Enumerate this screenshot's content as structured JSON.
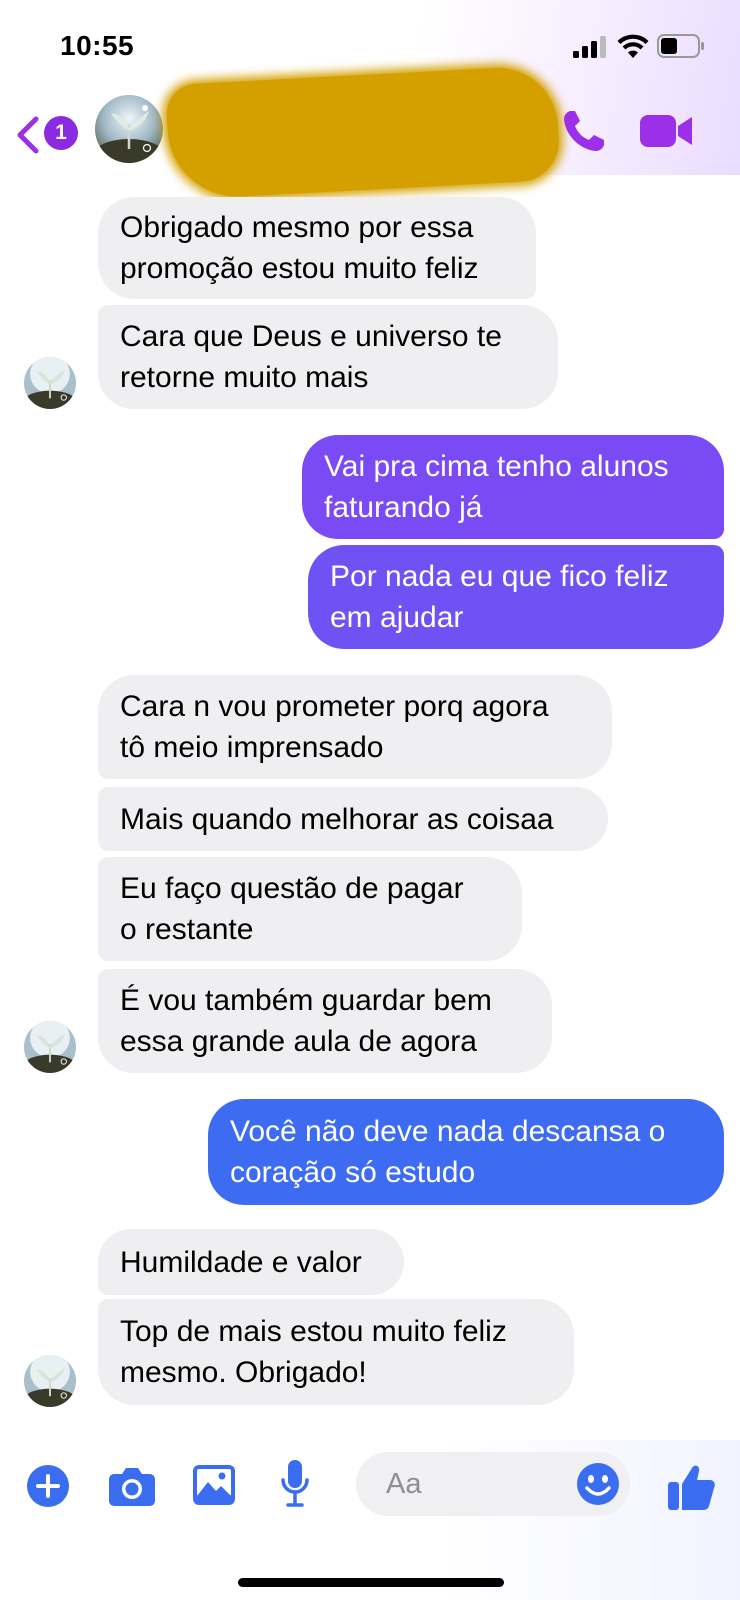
{
  "status_bar": {
    "time": "10:55"
  },
  "header": {
    "back_badge_count": "1",
    "accent_color": "#9b30e8"
  },
  "messages": [
    {
      "id": "m1",
      "direction": "in",
      "text": "Obrigado mesmo por essa\npromoção estou muito feliz"
    },
    {
      "id": "m2",
      "direction": "in",
      "text": "Cara que Deus e universo te\nretorne muito mais"
    },
    {
      "id": "m3",
      "direction": "out",
      "text": "Vai pra cima tenho alunos\nfaturando já",
      "color": "#7a4bf5"
    },
    {
      "id": "m4",
      "direction": "out",
      "text": "Por nada eu que fico feliz\nem ajudar",
      "color": "#6f52f4"
    },
    {
      "id": "m5",
      "direction": "in",
      "text": "Cara n vou prometer porq agora\ntô meio imprensado"
    },
    {
      "id": "m6",
      "direction": "in",
      "text": "Mais quando melhorar as coisaa"
    },
    {
      "id": "m7",
      "direction": "in",
      "text": "Eu faço questão de pagar\no restante"
    },
    {
      "id": "m8",
      "direction": "in",
      "text": "É vou também guardar bem\nessa grande aula de agora"
    },
    {
      "id": "m9",
      "direction": "out",
      "text": "Você não deve nada descansa o\ncoração só estudo",
      "color": "#3d6cf3"
    },
    {
      "id": "m10",
      "direction": "in",
      "text": "Humildade e valor"
    },
    {
      "id": "m11",
      "direction": "in",
      "text": "Top de mais estou muito feliz\nmesmo. Obrigado!"
    }
  ],
  "composer": {
    "placeholder": "Aa",
    "icons": [
      "plus-icon",
      "camera-icon",
      "image-icon",
      "microphone-icon",
      "emoji-icon",
      "thumbs-up-icon"
    ],
    "icon_color": "#3a6df0"
  }
}
